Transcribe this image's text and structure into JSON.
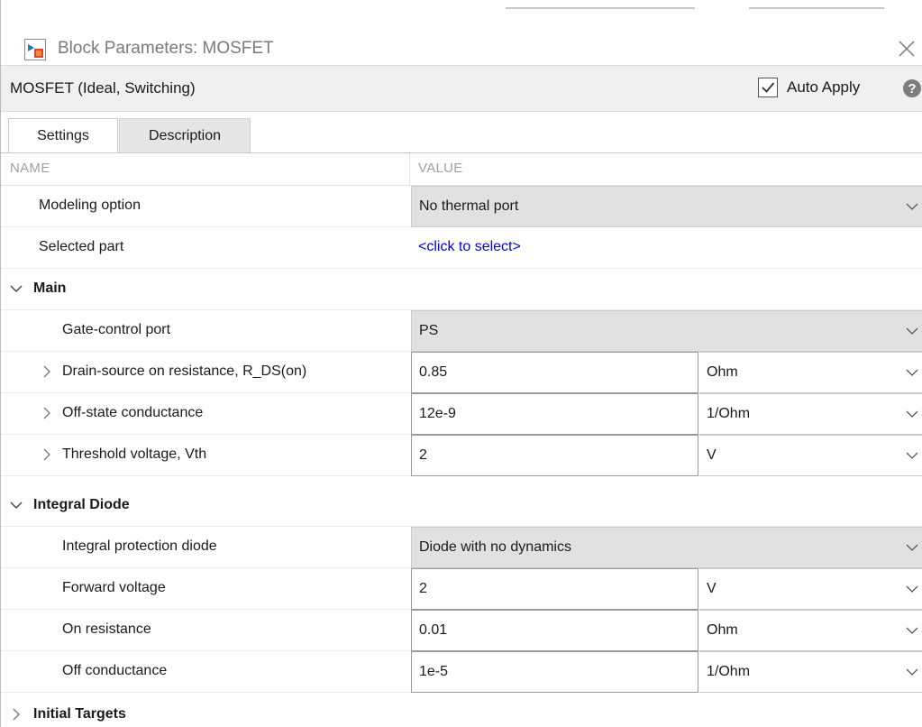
{
  "window": {
    "title": "Block Parameters: MOSFET",
    "icon": "simulink-block-icon",
    "close_icon": "close-icon"
  },
  "header": {
    "block_name": "MOSFET (Ideal, Switching)",
    "auto_apply_label": "Auto Apply",
    "auto_apply_checked": true,
    "help_icon": "help-icon"
  },
  "tabs": [
    {
      "label": "Settings",
      "active": true
    },
    {
      "label": "Description",
      "active": false
    }
  ],
  "table": {
    "col_name": "NAME",
    "col_value": "VALUE",
    "modeling_option": {
      "label": "Modeling option",
      "value": "No thermal port"
    },
    "selected_part": {
      "label": "Selected part",
      "value": "<click to select>"
    },
    "main": {
      "label": "Main",
      "gate_control": {
        "label": "Gate-control port",
        "value": "PS"
      },
      "rds_on": {
        "label": "Drain-source on resistance, R_DS(on)",
        "value": "0.85",
        "unit": "Ohm"
      },
      "off_conductance": {
        "label": "Off-state conductance",
        "value": "12e-9",
        "unit": "1/Ohm"
      },
      "vth": {
        "label": "Threshold voltage, Vth",
        "value": "2",
        "unit": "V"
      }
    },
    "integral_diode": {
      "label": "Integral Diode",
      "protection": {
        "label": "Integral protection diode",
        "value": "Diode with no dynamics"
      },
      "forward_voltage": {
        "label": "Forward voltage",
        "value": "2",
        "unit": "V"
      },
      "on_resistance": {
        "label": "On resistance",
        "value": "0.01",
        "unit": "Ohm"
      },
      "off_conductance": {
        "label": "Off conductance",
        "value": "1e-5",
        "unit": "1/Ohm"
      }
    },
    "initial_targets": {
      "label": "Initial Targets"
    }
  },
  "colors": {
    "link": "#0000ee",
    "header_bg": "#f0f0f0",
    "dropdown_bg": "#e1e1e1"
  }
}
